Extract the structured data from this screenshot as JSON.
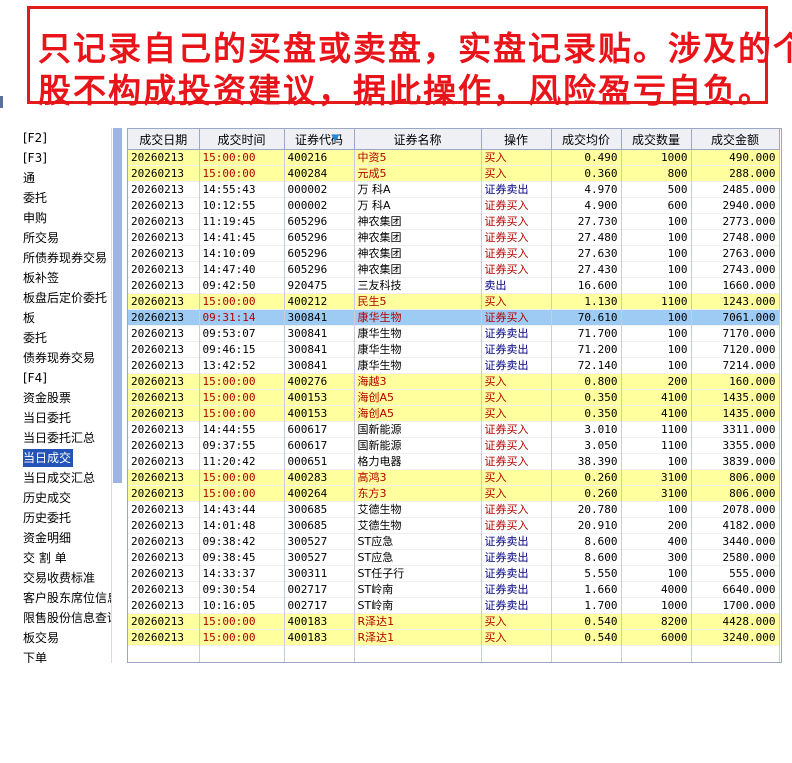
{
  "banner": {
    "line1": "只记录自己的买盘或卖盘，实盘记录贴。涉及的个",
    "line2": "股不构成投资建议，据此操作，风险盈亏自负。"
  },
  "sidebar": {
    "items": [
      {
        "label": "[F2]"
      },
      {
        "label": "[F3]"
      },
      {
        "label": "通"
      },
      {
        "label": "委托"
      },
      {
        "label": "申购"
      },
      {
        "label": "所交易"
      },
      {
        "label": "所债券现券交易"
      },
      {
        "label": "板补签"
      },
      {
        "label": "板盘后定价委托"
      },
      {
        "label": "板"
      },
      {
        "label": "委托"
      },
      {
        "label": "债券现券交易"
      },
      {
        "label": "[F4]"
      },
      {
        "label": "资金股票"
      },
      {
        "label": "当日委托"
      },
      {
        "label": "当日委托汇总"
      },
      {
        "label": "当日成交"
      },
      {
        "label": "当日成交汇总"
      },
      {
        "label": "历史成交"
      },
      {
        "label": "历史委托"
      },
      {
        "label": "资金明细"
      },
      {
        "label": "交 割 单"
      },
      {
        "label": "交易收费标准"
      },
      {
        "label": "客户股东席位信息"
      },
      {
        "label": "限售股份信息查询"
      },
      {
        "label": "板交易"
      },
      {
        "label": "下单"
      }
    ],
    "selected_index": 16
  },
  "table": {
    "columns": [
      "成交日期",
      "成交时间",
      "证券代码",
      "证券名称",
      "操作",
      "成交均价",
      "成交数量",
      "成交金额"
    ],
    "rows": [
      {
        "date": "20260213",
        "time": "15:00:00",
        "code": "400216",
        "name": "中资5",
        "op": "买入",
        "price": "0.490",
        "qty": "1000",
        "amount": "490.000",
        "style": "yellow"
      },
      {
        "date": "20260213",
        "time": "15:00:00",
        "code": "400284",
        "name": "元成5",
        "op": "买入",
        "price": "0.360",
        "qty": "800",
        "amount": "288.000",
        "style": "yellow"
      },
      {
        "date": "20260213",
        "time": "14:55:43",
        "code": "000002",
        "name": "万 科A",
        "op": "证券卖出",
        "price": "4.970",
        "qty": "500",
        "amount": "2485.000",
        "style": "white"
      },
      {
        "date": "20260213",
        "time": "10:12:55",
        "code": "000002",
        "name": "万 科A",
        "op": "证券买入",
        "price": "4.900",
        "qty": "600",
        "amount": "2940.000",
        "style": "white"
      },
      {
        "date": "20260213",
        "time": "11:19:45",
        "code": "605296",
        "name": "神农集团",
        "op": "证券买入",
        "price": "27.730",
        "qty": "100",
        "amount": "2773.000",
        "style": "white"
      },
      {
        "date": "20260213",
        "time": "14:41:45",
        "code": "605296",
        "name": "神农集团",
        "op": "证券买入",
        "price": "27.480",
        "qty": "100",
        "amount": "2748.000",
        "style": "white"
      },
      {
        "date": "20260213",
        "time": "14:10:09",
        "code": "605296",
        "name": "神农集团",
        "op": "证券买入",
        "price": "27.630",
        "qty": "100",
        "amount": "2763.000",
        "style": "white"
      },
      {
        "date": "20260213",
        "time": "14:47:40",
        "code": "605296",
        "name": "神农集团",
        "op": "证券买入",
        "price": "27.430",
        "qty": "100",
        "amount": "2743.000",
        "style": "white"
      },
      {
        "date": "20260213",
        "time": "09:42:50",
        "code": "920475",
        "name": "三友科技",
        "op": "卖出",
        "price": "16.600",
        "qty": "100",
        "amount": "1660.000",
        "style": "white"
      },
      {
        "date": "20260213",
        "time": "15:00:00",
        "code": "400212",
        "name": "民生5",
        "op": "买入",
        "price": "1.130",
        "qty": "1100",
        "amount": "1243.000",
        "style": "yellow"
      },
      {
        "date": "20260213",
        "time": "09:31:14",
        "code": "300841",
        "name": "康华生物",
        "op": "证券买入",
        "price": "70.610",
        "qty": "100",
        "amount": "7061.000",
        "style": "sel"
      },
      {
        "date": "20260213",
        "time": "09:53:07",
        "code": "300841",
        "name": "康华生物",
        "op": "证券卖出",
        "price": "71.700",
        "qty": "100",
        "amount": "7170.000",
        "style": "white"
      },
      {
        "date": "20260213",
        "time": "09:46:15",
        "code": "300841",
        "name": "康华生物",
        "op": "证券卖出",
        "price": "71.200",
        "qty": "100",
        "amount": "7120.000",
        "style": "white"
      },
      {
        "date": "20260213",
        "time": "13:42:52",
        "code": "300841",
        "name": "康华生物",
        "op": "证券卖出",
        "price": "72.140",
        "qty": "100",
        "amount": "7214.000",
        "style": "white"
      },
      {
        "date": "20260213",
        "time": "15:00:00",
        "code": "400276",
        "name": "海越3",
        "op": "买入",
        "price": "0.800",
        "qty": "200",
        "amount": "160.000",
        "style": "yellow"
      },
      {
        "date": "20260213",
        "time": "15:00:00",
        "code": "400153",
        "name": "海创A5",
        "op": "买入",
        "price": "0.350",
        "qty": "4100",
        "amount": "1435.000",
        "style": "yellow"
      },
      {
        "date": "20260213",
        "time": "15:00:00",
        "code": "400153",
        "name": "海创A5",
        "op": "买入",
        "price": "0.350",
        "qty": "4100",
        "amount": "1435.000",
        "style": "yellow"
      },
      {
        "date": "20260213",
        "time": "14:44:55",
        "code": "600617",
        "name": "国新能源",
        "op": "证券买入",
        "price": "3.010",
        "qty": "1100",
        "amount": "3311.000",
        "style": "white"
      },
      {
        "date": "20260213",
        "time": "09:37:55",
        "code": "600617",
        "name": "国新能源",
        "op": "证券买入",
        "price": "3.050",
        "qty": "1100",
        "amount": "3355.000",
        "style": "white"
      },
      {
        "date": "20260213",
        "time": "11:20:42",
        "code": "000651",
        "name": "格力电器",
        "op": "证券买入",
        "price": "38.390",
        "qty": "100",
        "amount": "3839.000",
        "style": "white"
      },
      {
        "date": "20260213",
        "time": "15:00:00",
        "code": "400283",
        "name": "高鸿3",
        "op": "买入",
        "price": "0.260",
        "qty": "3100",
        "amount": "806.000",
        "style": "yellow"
      },
      {
        "date": "20260213",
        "time": "15:00:00",
        "code": "400264",
        "name": "东方3",
        "op": "买入",
        "price": "0.260",
        "qty": "3100",
        "amount": "806.000",
        "style": "yellow"
      },
      {
        "date": "20260213",
        "time": "14:43:44",
        "code": "300685",
        "name": "艾德生物",
        "op": "证券买入",
        "price": "20.780",
        "qty": "100",
        "amount": "2078.000",
        "style": "white"
      },
      {
        "date": "20260213",
        "time": "14:01:48",
        "code": "300685",
        "name": "艾德生物",
        "op": "证券买入",
        "price": "20.910",
        "qty": "200",
        "amount": "4182.000",
        "style": "white"
      },
      {
        "date": "20260213",
        "time": "09:38:42",
        "code": "300527",
        "name": "ST应急",
        "op": "证券卖出",
        "price": "8.600",
        "qty": "400",
        "amount": "3440.000",
        "style": "white"
      },
      {
        "date": "20260213",
        "time": "09:38:45",
        "code": "300527",
        "name": "ST应急",
        "op": "证券卖出",
        "price": "8.600",
        "qty": "300",
        "amount": "2580.000",
        "style": "white"
      },
      {
        "date": "20260213",
        "time": "14:33:37",
        "code": "300311",
        "name": "ST任子行",
        "op": "证券卖出",
        "price": "5.550",
        "qty": "100",
        "amount": "555.000",
        "style": "white"
      },
      {
        "date": "20260213",
        "time": "09:30:54",
        "code": "002717",
        "name": "ST岭南",
        "op": "证券卖出",
        "price": "1.660",
        "qty": "4000",
        "amount": "6640.000",
        "style": "white"
      },
      {
        "date": "20260213",
        "time": "10:16:05",
        "code": "002717",
        "name": "ST岭南",
        "op": "证券卖出",
        "price": "1.700",
        "qty": "1000",
        "amount": "1700.000",
        "style": "white"
      },
      {
        "date": "20260213",
        "time": "15:00:00",
        "code": "400183",
        "name": "R泽达1",
        "op": "买入",
        "price": "0.540",
        "qty": "8200",
        "amount": "4428.000",
        "style": "yellow"
      },
      {
        "date": "20260213",
        "time": "15:00:00",
        "code": "400183",
        "name": "R泽达1",
        "op": "买入",
        "price": "0.540",
        "qty": "6000",
        "amount": "3240.000",
        "style": "yellow"
      }
    ]
  }
}
